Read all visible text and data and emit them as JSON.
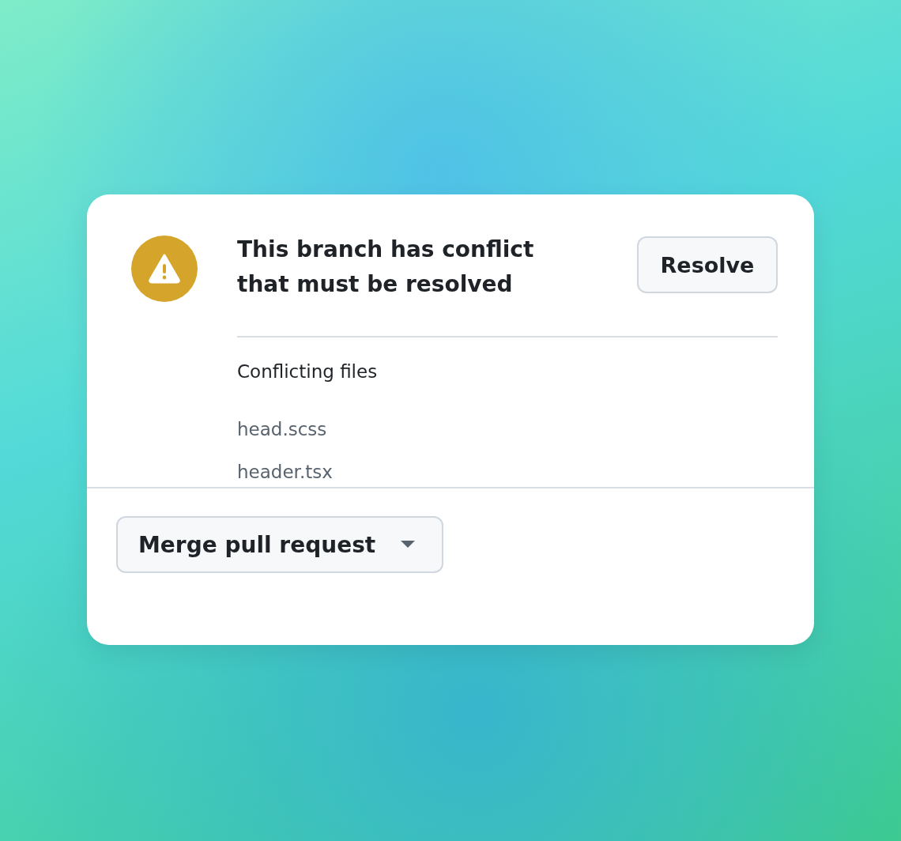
{
  "alert": {
    "title": "This branch has conflict that must be resolved",
    "action": "Resolve"
  },
  "conflicts": {
    "heading": "Conflicting files",
    "files": [
      "head.scss",
      "header.tsx"
    ]
  },
  "merge_button": {
    "label": "Merge pull request"
  }
}
